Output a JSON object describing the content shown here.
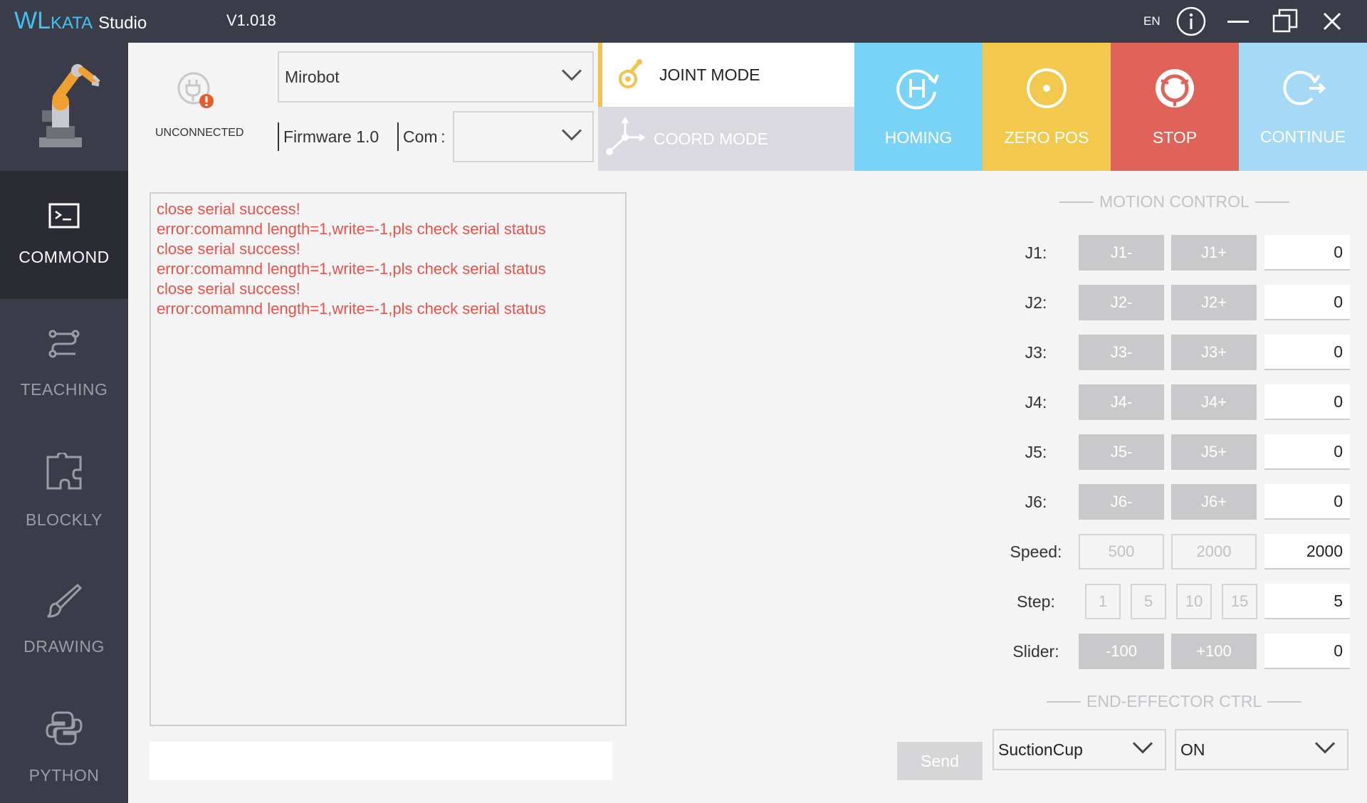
{
  "app": {
    "logo_wl": "WL",
    "logo_kata": "KATA",
    "logo_studio": "Studio",
    "version": "V1.018",
    "language": "EN"
  },
  "icons": {
    "info": "info-icon",
    "minimize": "minimize-icon",
    "restore": "restore-icon",
    "close": "close-icon"
  },
  "sidebar": {
    "items": [
      {
        "label": "COMMOND",
        "icon": "terminal-icon",
        "active": true
      },
      {
        "label": "TEACHING",
        "icon": "route-icon",
        "active": false
      },
      {
        "label": "BLOCKLY",
        "icon": "puzzle-icon",
        "active": false
      },
      {
        "label": "DRAWING",
        "icon": "brush-icon",
        "active": false
      },
      {
        "label": "PYTHON",
        "icon": "python-icon",
        "active": false
      }
    ]
  },
  "connection": {
    "status": "UNCONNECTED",
    "device": "Mirobot",
    "firmware_label": "Firmware 1.0",
    "com_label": "Com :",
    "com_value": ""
  },
  "modes": {
    "joint": "JOINT MODE",
    "coord": "COORD MODE"
  },
  "actions": [
    {
      "label": "HOMING",
      "color": "#79d3f6",
      "icon": "homing-icon"
    },
    {
      "label": "ZERO POS",
      "color": "#f2c94c",
      "icon": "zero-pos-icon"
    },
    {
      "label": "STOP",
      "color": "#e0635a",
      "icon": "stop-icon"
    },
    {
      "label": "CONTINUE",
      "color": "#a5d9f5",
      "icon": "continue-icon"
    }
  ],
  "console": {
    "lines": [
      "close serial success!",
      "error:comamnd length=1,write=-1,pls check serial status",
      "close serial success!",
      "error:comamnd length=1,write=-1,pls check serial status",
      "close serial success!",
      "error:comamnd length=1,write=-1,pls check serial status"
    ],
    "input_value": "",
    "send_label": "Send"
  },
  "motion": {
    "title": "MOTION CONTROL",
    "joints": [
      {
        "label": "J1:",
        "minus": "J1-",
        "plus": "J1+",
        "value": "0"
      },
      {
        "label": "J2:",
        "minus": "J2-",
        "plus": "J2+",
        "value": "0"
      },
      {
        "label": "J3:",
        "minus": "J3-",
        "plus": "J3+",
        "value": "0"
      },
      {
        "label": "J4:",
        "minus": "J4-",
        "plus": "J4+",
        "value": "0"
      },
      {
        "label": "J5:",
        "minus": "J5-",
        "plus": "J5+",
        "value": "0"
      },
      {
        "label": "J6:",
        "minus": "J6-",
        "plus": "J6+",
        "value": "0"
      }
    ],
    "speed": {
      "label": "Speed:",
      "presets": [
        "500",
        "2000"
      ],
      "value": "2000"
    },
    "step": {
      "label": "Step:",
      "presets": [
        "1",
        "5",
        "10",
        "15"
      ],
      "value": "5"
    },
    "slider": {
      "label": "Slider:",
      "minus": "-100",
      "plus": "+100",
      "value": "0"
    }
  },
  "end_effector": {
    "title": "END-EFFECTOR CTRL",
    "tool": "SuctionCup",
    "state": "ON"
  },
  "colors": {
    "titlebar": "#3a3c4a",
    "accent": "#3ec3f4",
    "log_text": "#e5534b",
    "joint_mode_accent": "#f2c44e"
  }
}
